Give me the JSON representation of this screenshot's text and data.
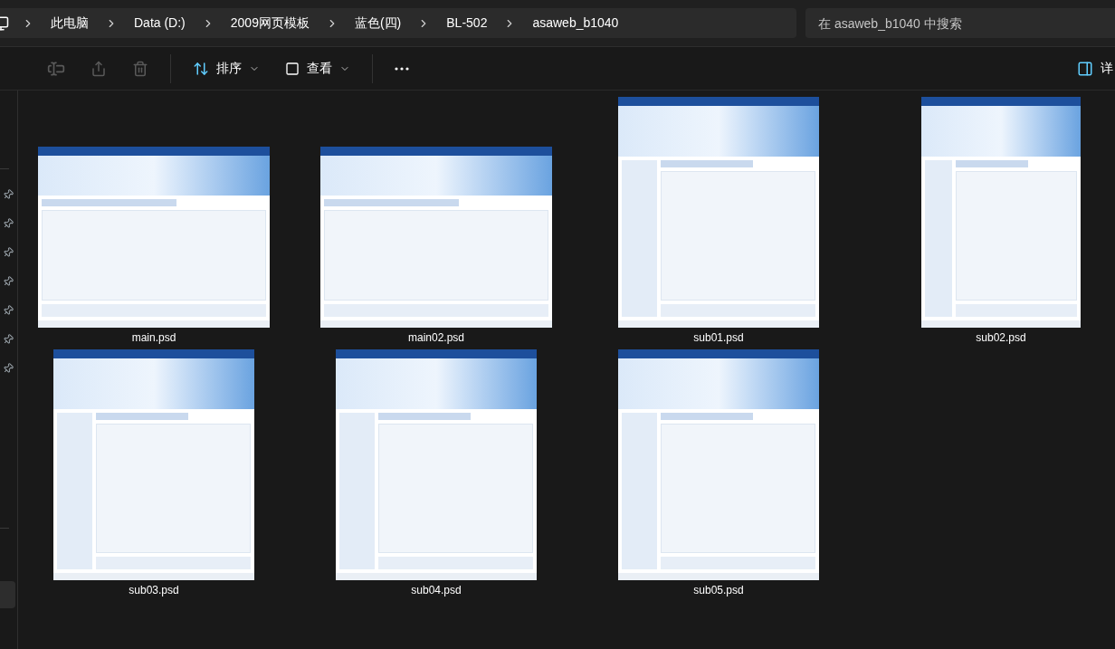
{
  "address_bar": {
    "segments": [
      "此电脑",
      "Data (D:)",
      "2009网页模板",
      "蓝色(四)",
      "BL-502",
      "asaweb_b1040"
    ]
  },
  "search": {
    "placeholder": "在 asaweb_b1040 中搜索"
  },
  "toolbar": {
    "actions": [
      {
        "kind": "rename",
        "disabled": true
      },
      {
        "kind": "share",
        "disabled": true
      },
      {
        "kind": "delete",
        "disabled": true
      },
      {
        "kind": "sort",
        "label": "排序"
      },
      {
        "kind": "view",
        "label": "查看"
      },
      {
        "kind": "more"
      }
    ],
    "details": {
      "label": "详"
    }
  },
  "files": [
    {
      "name": "main.psd",
      "kind": "landscape"
    },
    {
      "name": "main02.psd",
      "kind": "landscape"
    },
    {
      "name": "sub01.psd",
      "kind": "portrait"
    },
    {
      "name": "sub02.psd",
      "kind": "narrow"
    },
    {
      "name": "sub03.psd",
      "kind": "portrait"
    },
    {
      "name": "sub04.psd",
      "kind": "portrait"
    },
    {
      "name": "sub05.psd",
      "kind": "portrait"
    }
  ]
}
